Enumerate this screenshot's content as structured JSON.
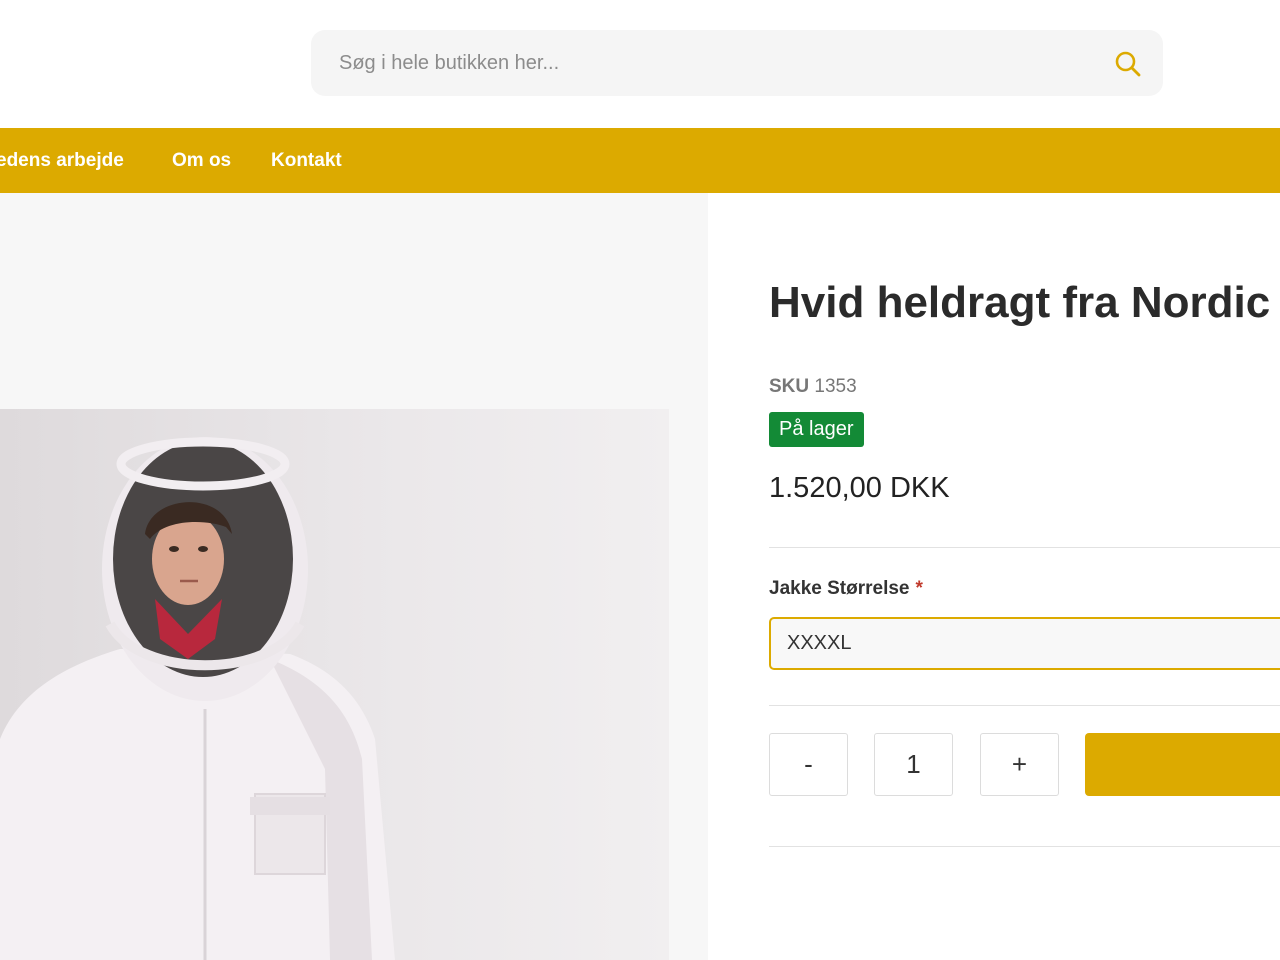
{
  "search": {
    "placeholder": "Søg i hele butikken her...",
    "value": ""
  },
  "nav": {
    "items": [
      {
        "label": "edens arbejde"
      },
      {
        "label": "Om os"
      },
      {
        "label": "Kontakt"
      }
    ]
  },
  "product": {
    "title": "Hvid heldragt fra Nordic",
    "sku_label": "SKU",
    "sku_value": "1353",
    "stock_status": "På lager",
    "price": "1.520,00 DKK",
    "option_label": "Jakke Størrelse",
    "option_required": "*",
    "option_selected": "XXXXL",
    "qty_minus": "-",
    "qty_value": "1",
    "qty_plus": "+"
  },
  "colors": {
    "brand": "#dcaa00",
    "stock": "#138a36"
  },
  "icons": {
    "search": "search-icon"
  }
}
